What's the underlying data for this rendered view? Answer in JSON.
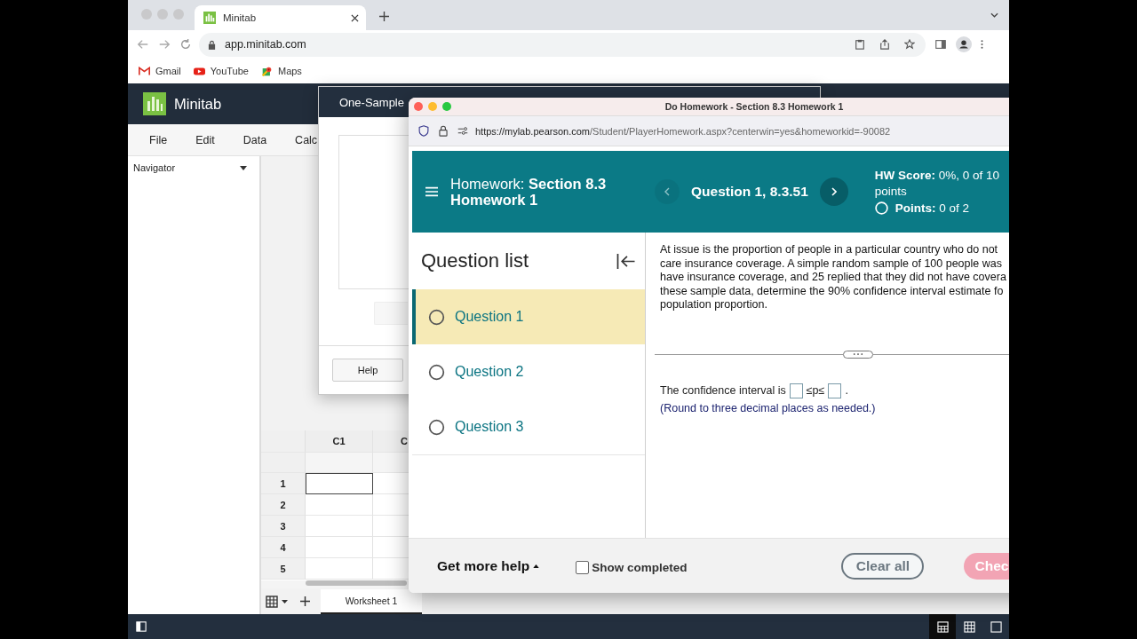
{
  "browser": {
    "tab_title": "Minitab",
    "url": "app.minitab.com",
    "bookmarks": [
      {
        "label": "Gmail",
        "kind": "gmail"
      },
      {
        "label": "YouTube",
        "kind": "youtube"
      },
      {
        "label": "Maps",
        "kind": "maps"
      }
    ]
  },
  "minitab": {
    "app_name": "Minitab",
    "menu": [
      "File",
      "Edit",
      "Data",
      "Calc"
    ],
    "navigator": "Navigator",
    "worksheet": {
      "columns": [
        "C1",
        "C"
      ],
      "rows": [
        "1",
        "2",
        "3",
        "4",
        "5"
      ],
      "tab": "Worksheet 1"
    },
    "view_buttons": [
      {
        "kind": "split",
        "selected": true
      },
      {
        "kind": "grid",
        "selected": false
      },
      {
        "kind": "single",
        "selected": false
      }
    ]
  },
  "dialog": {
    "title": "One-Sample",
    "buttons": [
      {
        "label": "Help",
        "disabled": false,
        "kind": "footer"
      }
    ]
  },
  "homework": {
    "window_title": "Do Homework - Section 8.3 Homework 1",
    "url_host": "https://mylab.pearson.com",
    "url_path": "/Student/PlayerHomework.aspx?centerwin=yes&homeworkid=-90082",
    "title": "Homework:  **Section 8.3 Homework 1**",
    "question_label": "Question 1, 8.3.51",
    "prev": {
      "disabled": true
    },
    "next": {
      "disabled": false
    },
    "score": "**HW Score:** 0%, 0 of 10 points",
    "points": "**Points:** 0 of 2",
    "question_list": {
      "heading": "Question list",
      "items": [
        {
          "label": "Question 1",
          "selected": true
        },
        {
          "label": "Question 2",
          "selected": false
        },
        {
          "label": "Question 3",
          "selected": false
        }
      ]
    },
    "question_lines": [
      "At issue is the proportion of people in a particular country who do not",
      "care insurance coverage. A simple random sample of 100 people was",
      "have insurance coverage, and 25 replied that they did not have covera",
      "these sample data, determine the 90% confidence interval estimate fo",
      "population proportion."
    ],
    "answer": {
      "prefix": "The confidence interval is",
      "middle": "≤p≤",
      "suffix": "."
    },
    "hint": "(Round to three decimal places as needed.)",
    "footer": {
      "help": "Get more help",
      "show_completed": {
        "label": "Show completed",
        "checked": false
      },
      "clear": "Clear all",
      "check": "Chec"
    }
  }
}
